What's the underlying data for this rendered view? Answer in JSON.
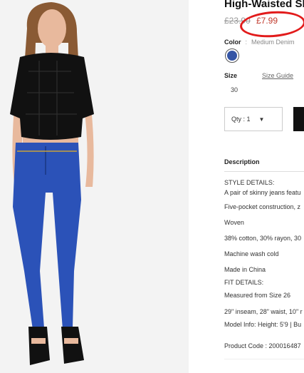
{
  "product": {
    "title": "High-Waisted Sk",
    "price_old": "£23.90",
    "price_new": "£7.99",
    "color_label": "Color",
    "color_separator": ":",
    "color_value": "Medium Denim",
    "swatch_color": "#3555a5",
    "size_label": "Size",
    "size_guide": "Size Guide",
    "size_option": "30",
    "qty_label": "Qty : 1",
    "qty_caret": "▼"
  },
  "description": {
    "heading": "Description",
    "lines": [
      "STYLE DETAILS:",
      "A pair of skinny jeans featu",
      "Five-pocket construction, z",
      "Woven",
      "38% cotton, 30% rayon, 30",
      "Machine wash cold",
      "Made in China",
      "FIT DETAILS:",
      "Measured from Size 26",
      "29\" inseam, 28\" waist, 10\" r",
      "Model Info: Height: 5'9 | Bu",
      "Product Code : 200016487"
    ]
  },
  "image": {
    "top_color": "#111111",
    "jeans_color": "#2b52b8",
    "skin_color": "#e8b99d",
    "hair_color": "#8a5a34",
    "shoe_color": "#111111"
  },
  "annotation": {
    "circle_color": "#e21b1b"
  }
}
